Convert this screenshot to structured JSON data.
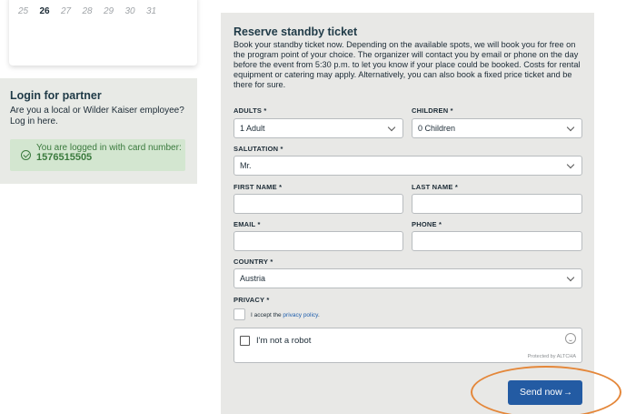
{
  "calendar": {
    "days": [
      "25",
      "26",
      "27",
      "28",
      "29",
      "30",
      "31"
    ],
    "active_day": "26"
  },
  "login": {
    "title": "Login for partner",
    "text": "Are you a local or Wilder Kaiser employee? Log in here.",
    "status_prefix": "You are logged in with card number: ",
    "card_number": "1576515505"
  },
  "reserve": {
    "title": "Reserve standby ticket",
    "description": "Book your standby ticket now. Depending on the available spots, we will book you for free on the program point of your choice. The organizer will contact you by email or phone on the day before the event from 5:30 p.m. to let you know if your place could be booked. Costs for rental equipment or catering may apply. Alternatively, you can also book a fixed price ticket and be there for sure.",
    "adults_label": "ADULTS *",
    "adults_value": "1 Adult",
    "children_label": "CHILDREN *",
    "children_value": "0 Children",
    "salutation_label": "SALUTATION *",
    "salutation_value": "Mr.",
    "firstname_label": "FIRST NAME *",
    "firstname_value": "",
    "lastname_label": "LAST NAME *",
    "lastname_value": "",
    "email_label": "EMAIL *",
    "email_value": "",
    "phone_label": "PHONE *",
    "phone_value": "",
    "country_label": "COUNTRY *",
    "country_value": "Austria",
    "privacy_label": "PRIVACY *",
    "privacy_text": "I accept the ",
    "privacy_link": "privacy policy",
    "privacy_suffix": ".",
    "captcha_label": "I'm not a robot",
    "captcha_protected": "Protected by ALTCHA",
    "send_label": "Send now",
    "send_arrow": "→"
  },
  "colors": {
    "accent": "#235ba3",
    "success": "#3a7a3d",
    "highlight": "#e4873a",
    "panel_bg": "#e8e8e6"
  }
}
